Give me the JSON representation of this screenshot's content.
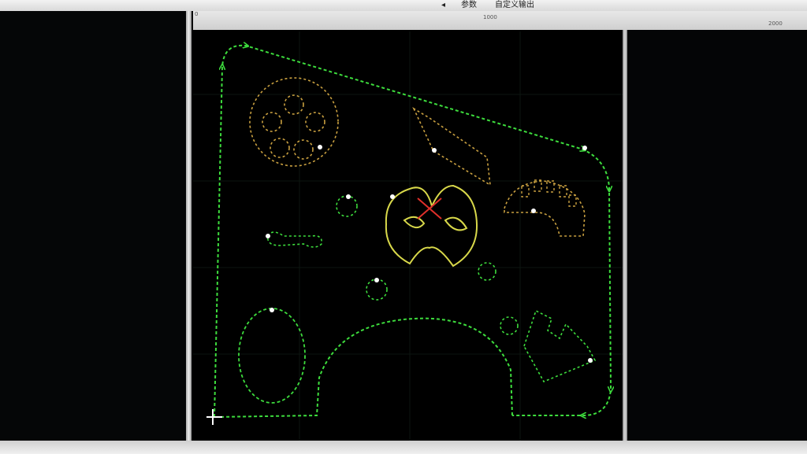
{
  "toolbar": {
    "params_label": "参数",
    "custom_output_label": "自定义输出",
    "dropdown_arrow": "◂"
  },
  "ruler": {
    "mark_0": "0",
    "mark_1000": "1000",
    "mark_2000": "2000"
  },
  "colors": {
    "path_green": "#3ddc3d",
    "path_orange": "#c9a040",
    "path_yellow": "#d8d84a",
    "origin_red": "#e0302a",
    "background": "#000000"
  },
  "icons": {
    "origin_marker": "red-x-icon",
    "start_cursor": "crosshair-icon"
  }
}
